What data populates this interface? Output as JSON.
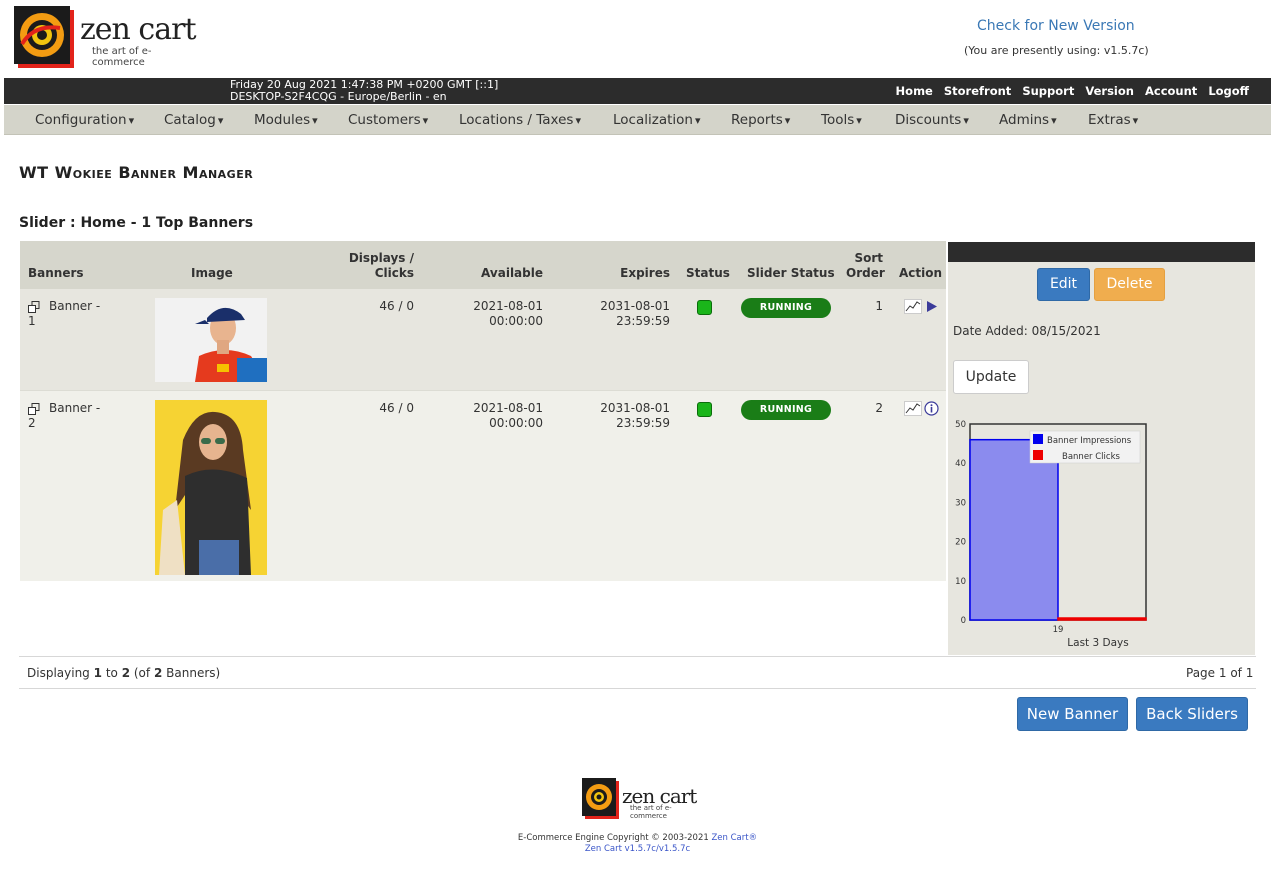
{
  "header": {
    "logo_word": "zen cart",
    "logo_tagline": "the art of e-commerce",
    "check_version": "Check for New Version",
    "using_version": "(You are presently using: v1.5.7c)"
  },
  "topbar": {
    "datetime_line1": "Friday 20 Aug 2021 1:47:38 PM +0200 GMT [::1]",
    "datetime_line2": "DESKTOP-S2F4CQG - Europe/Berlin - en",
    "links": [
      "Home",
      "Storefront",
      "Support",
      "Version",
      "Account",
      "Logoff"
    ]
  },
  "menu": [
    "Configuration",
    "Catalog",
    "Modules",
    "Customers",
    "Locations / Taxes",
    "Localization",
    "Reports",
    "Tools",
    "Discounts",
    "Admins",
    "Extras"
  ],
  "page": {
    "title": "WT Wokiee Banner Manager",
    "subtitle": "Slider : Home - 1 Top Banners"
  },
  "table": {
    "headers": {
      "banners": "Banners",
      "image": "Image",
      "displays_line1": "Displays /",
      "displays_line2": "Clicks",
      "available": "Available",
      "expires": "Expires",
      "status": "Status",
      "slider_status": "Slider Status",
      "sort_line1": "Sort",
      "sort_line2": "Order",
      "action": "Action"
    },
    "rows": [
      {
        "name_line1": "Banner -",
        "name_line2": "1",
        "image": "banner-1-image",
        "displays_clicks": "46 / 0",
        "available_date": "2021-08-01",
        "available_time": "00:00:00",
        "expires_date": "2031-08-01",
        "expires_time": "23:59:59",
        "status": "active",
        "slider_status": "RUNNING",
        "sort_order": "1",
        "action_icons": [
          "statistics-icon",
          "play-arrow-icon"
        ]
      },
      {
        "name_line1": "Banner -",
        "name_line2": "2",
        "image": "banner-2-image",
        "displays_clicks": "46 / 0",
        "available_date": "2021-08-01",
        "available_time": "00:00:00",
        "expires_date": "2031-08-01",
        "expires_time": "23:59:59",
        "status": "active",
        "slider_status": "RUNNING",
        "sort_order": "2",
        "action_icons": [
          "statistics-icon",
          "info-icon"
        ]
      }
    ]
  },
  "panel": {
    "edit_label": "Edit",
    "delete_label": "Delete",
    "date_added": "Date Added: 08/15/2021",
    "update_label": "Update"
  },
  "chart_data": {
    "type": "bar",
    "categories": [
      "19"
    ],
    "series": [
      {
        "name": "Banner Impressions",
        "values": [
          46
        ],
        "color": "#0000ee"
      },
      {
        "name": "Banner Clicks",
        "values": [
          0
        ],
        "color": "#ee0000"
      }
    ],
    "xlabel": "Last 3 Days",
    "ylabel": "",
    "ylim": [
      0,
      50
    ],
    "yticks": [
      0,
      10,
      20,
      30,
      40,
      50
    ],
    "legend": "top-right"
  },
  "footer": {
    "displaying_prefix": "Displaying",
    "displaying_from": "1",
    "displaying_to_word": "to",
    "displaying_to": "2",
    "displaying_of_prefix": "(of",
    "displaying_total": "2",
    "displaying_suffix": "Banners)",
    "page_info": "Page 1 of 1",
    "new_banner_label": "New Banner",
    "back_sliders_label": "Back Sliders",
    "copyright_text": "E-Commerce Engine Copyright © 2003-2021",
    "copyright_link": "Zen Cart®",
    "version_line": "Zen Cart v1.5.7c/v1.5.7c"
  },
  "colors": {
    "accent_blue": "#3a7ac0",
    "delete_orange": "#f0ad4e",
    "running_green": "#1a7d17",
    "dark_bar": "#2c2c2c"
  }
}
